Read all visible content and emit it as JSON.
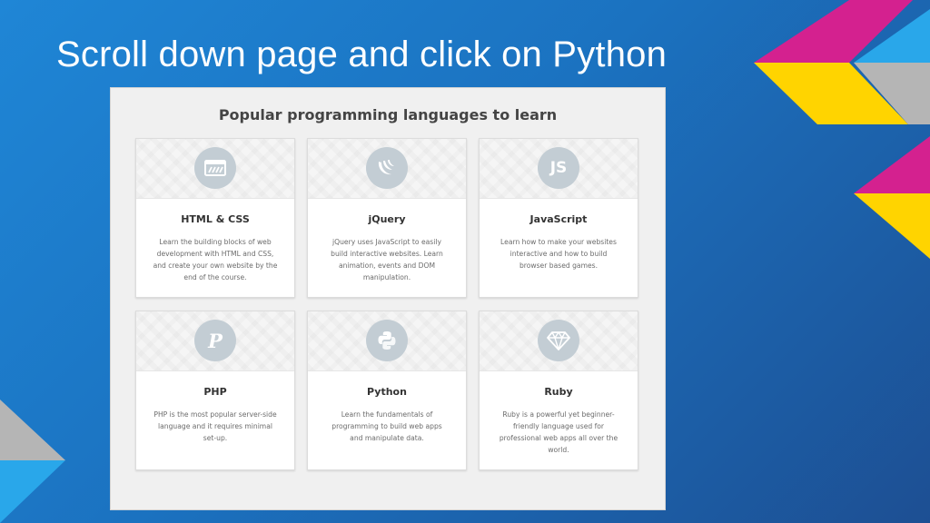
{
  "slide": {
    "title": "Scroll down page and click on Python"
  },
  "section": {
    "heading": "Popular programming languages to learn"
  },
  "courses": [
    {
      "name": "HTML & CSS",
      "icon": "html-css-icon",
      "description": "Learn the building blocks of web development with HTML and CSS, and create your own website by the end of the course."
    },
    {
      "name": "jQuery",
      "icon": "jquery-icon",
      "description": "jQuery uses JavaScript to easily build interactive websites. Learn animation, events and DOM manipulation."
    },
    {
      "name": "JavaScript",
      "icon": "javascript-icon",
      "icon_text": "JS",
      "description": "Learn how to make your websites interactive and how to build browser based games."
    },
    {
      "name": "PHP",
      "icon": "php-icon",
      "icon_text": "P",
      "description": "PHP is the most popular server-side language and it requires minimal set-up."
    },
    {
      "name": "Python",
      "icon": "python-icon",
      "description": "Learn the fundamentals of programming to build web apps and manipulate data."
    },
    {
      "name": "Ruby",
      "icon": "ruby-icon",
      "description": "Ruby is a powerful yet beginner-friendly language used for professional web apps all over the world."
    }
  ],
  "colors": {
    "background": "#1b72c0",
    "icon_circle": "#c3cdd4",
    "magenta": "#d4218f",
    "yellow": "#ffd400",
    "sky": "#29a7ea",
    "grey": "#b5b5b5"
  }
}
